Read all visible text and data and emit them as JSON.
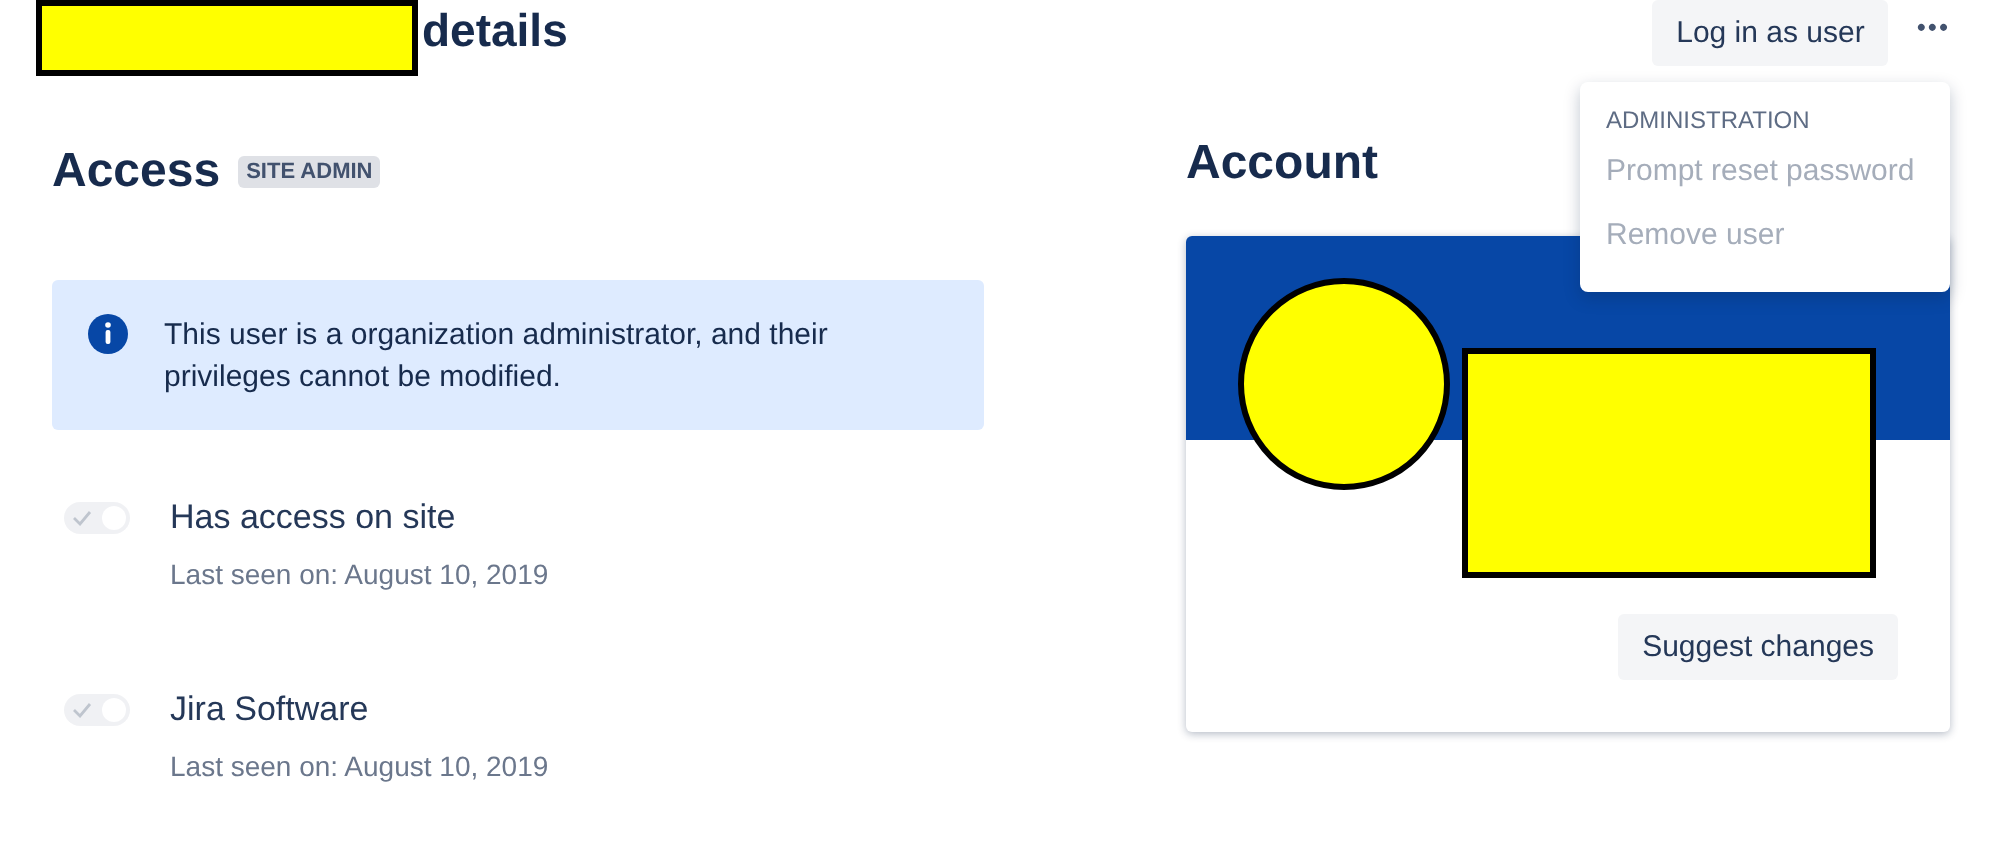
{
  "header": {
    "title": "details",
    "actions": [
      {
        "label": "Log in as user"
      }
    ],
    "more_icon": "•••"
  },
  "menu": {
    "heading": "ADMINISTRATION",
    "items": [
      {
        "label": "Prompt reset password",
        "disabled": true
      },
      {
        "label": "Remove user",
        "disabled": true
      }
    ]
  },
  "access": {
    "title": "Access",
    "badge": "SITE ADMIN",
    "info": "This user is a organization administrator, and their privileges cannot be modified.",
    "products": [
      {
        "name": "Has access on site",
        "last_seen": "Last seen on: August 10, 2019",
        "on": true,
        "disabled": true
      },
      {
        "name": "Jira Software",
        "last_seen": "Last seen on: August 10, 2019",
        "on": true,
        "disabled": true
      }
    ]
  },
  "account": {
    "title": "Account",
    "button": "Suggest changes"
  }
}
